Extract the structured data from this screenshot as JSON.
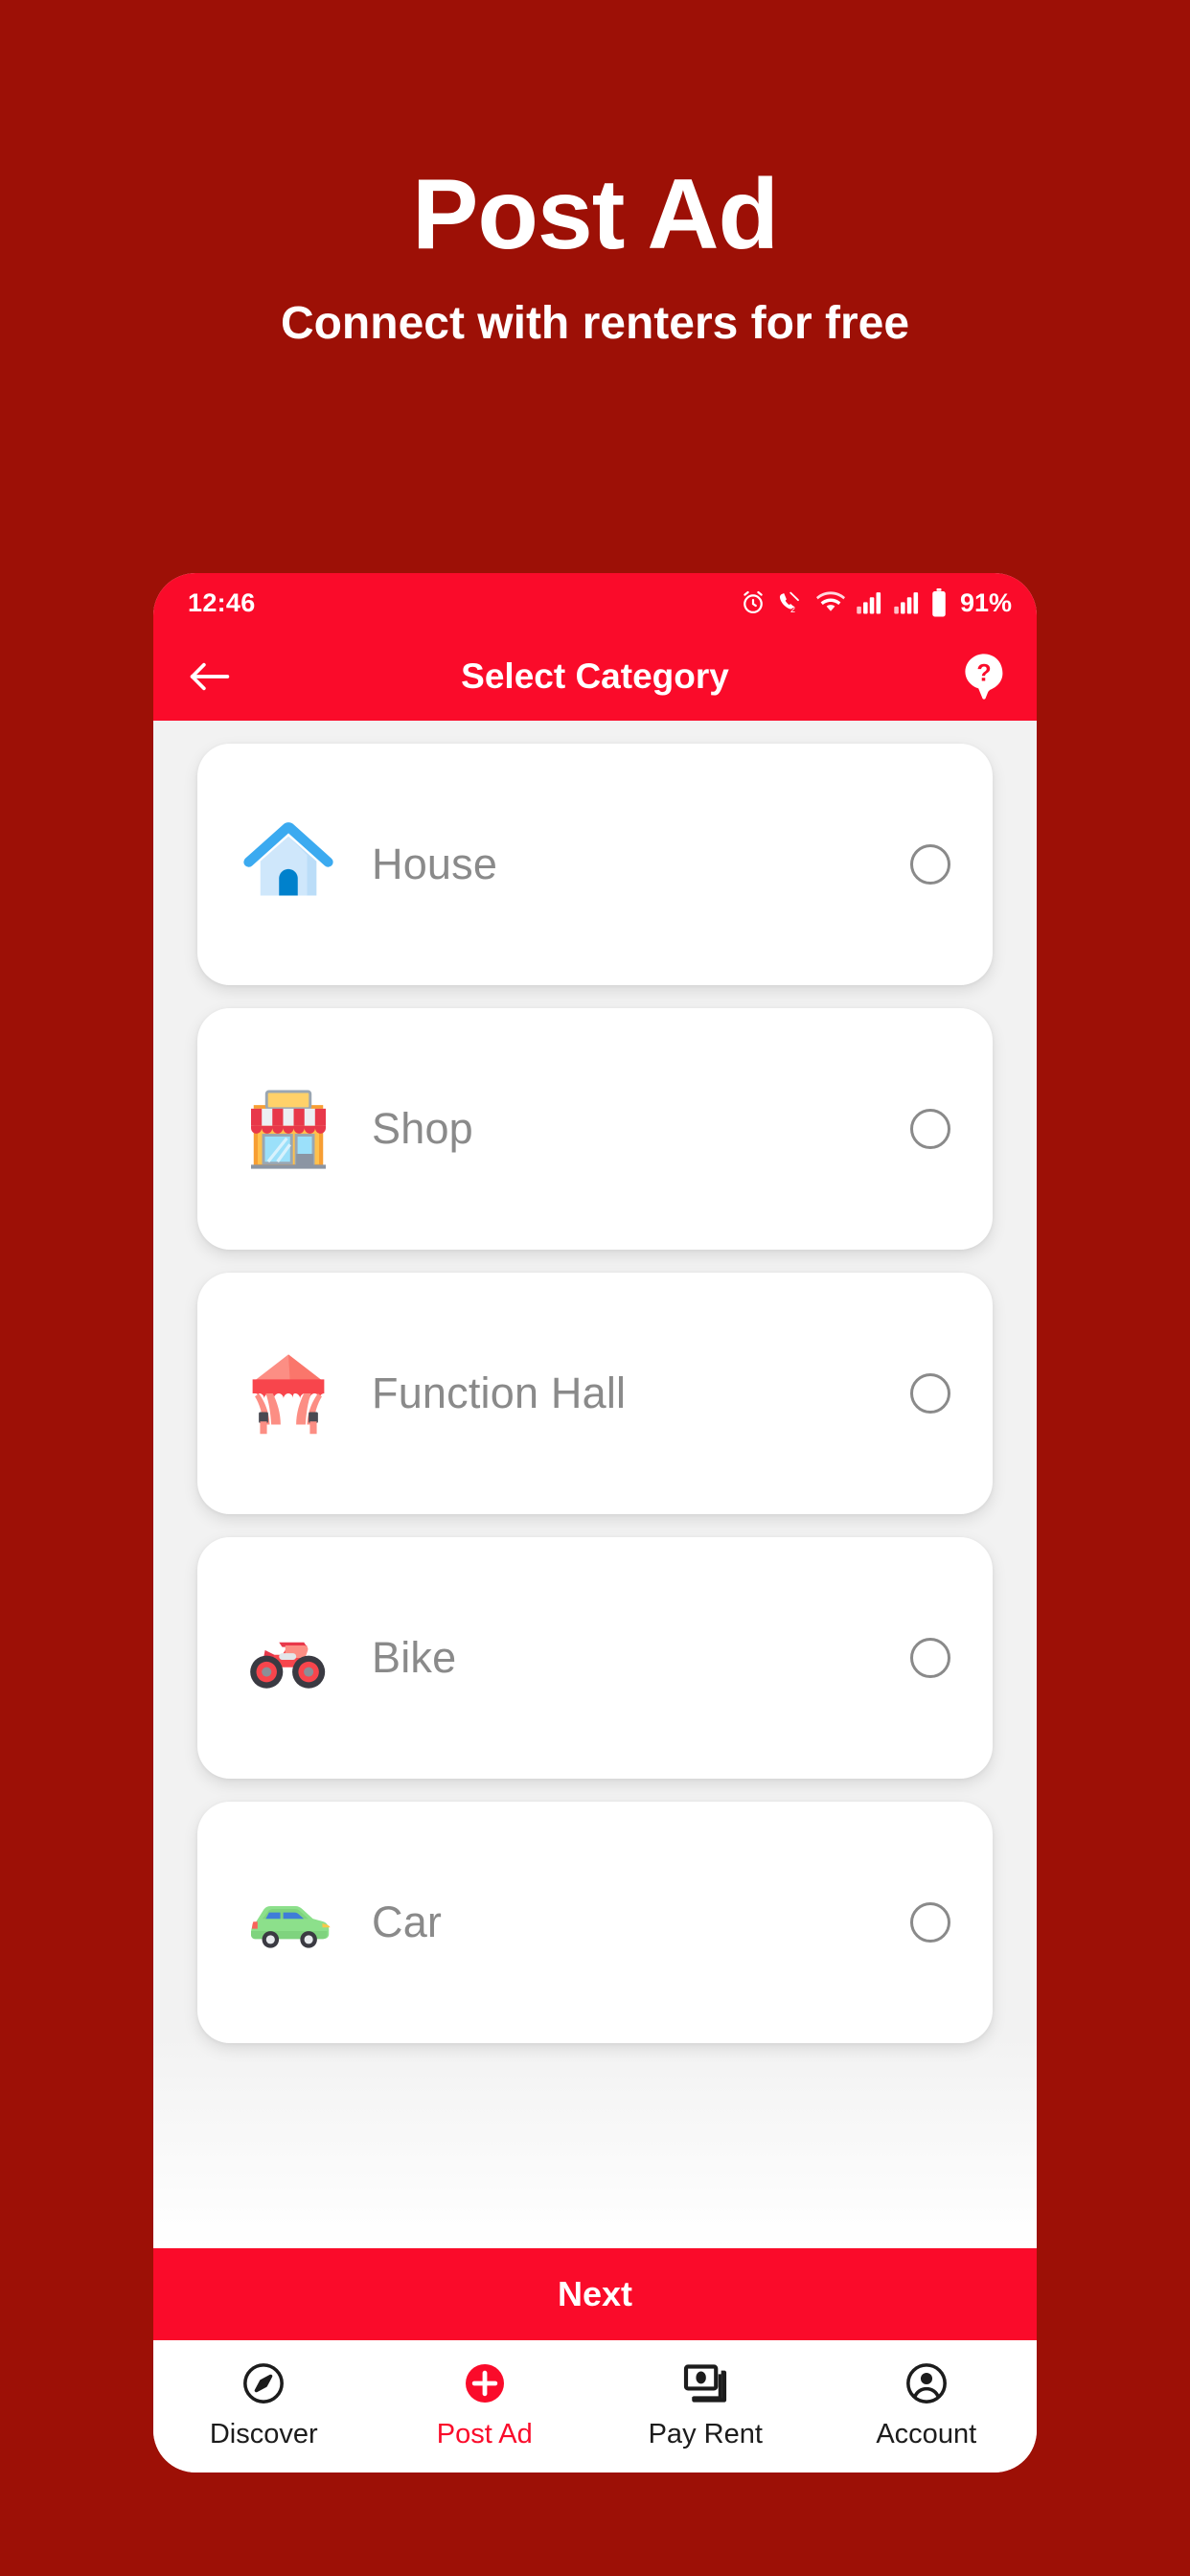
{
  "promo": {
    "title": "Post Ad",
    "subtitle": "Connect with renters for free",
    "background_color": "#9D1006",
    "text_color": "#FFFFFF"
  },
  "phone": {
    "statusbar": {
      "time": "12:46",
      "battery_percent": "91%",
      "icons": [
        "alarm-icon",
        "call-mute-dual-sim-icon",
        "wifi-icon",
        "signal-bars-1-icon",
        "signal-bars-2-icon",
        "battery-icon"
      ],
      "background_color": "#FA0B2A"
    },
    "appbar": {
      "back_label": "back-arrow-icon",
      "title": "Select Category",
      "help_label": "help-icon",
      "background_color": "#FA0B2A"
    },
    "categories": [
      {
        "label": "House",
        "icon": "house-icon",
        "selected": false
      },
      {
        "label": "Shop",
        "icon": "shop-icon",
        "selected": false
      },
      {
        "label": "Function Hall",
        "icon": "tent-icon",
        "selected": false
      },
      {
        "label": "Bike",
        "icon": "motorcycle-icon",
        "selected": false
      },
      {
        "label": "Car",
        "icon": "car-icon",
        "selected": false
      }
    ],
    "next_button": {
      "label": "Next",
      "background_color": "#FA0B2A",
      "text_color": "#FFFFFF"
    },
    "bottom_nav": {
      "active_color": "#FA0B2A",
      "inactive_color": "#1C1C1C",
      "items": [
        {
          "label": "Discover",
          "icon": "compass-icon",
          "active": false
        },
        {
          "label": "Post Ad",
          "icon": "plus-circle-icon",
          "active": true
        },
        {
          "label": "Pay Rent",
          "icon": "cards-icon",
          "active": false
        },
        {
          "label": "Account",
          "icon": "person-circle-icon",
          "active": false
        }
      ]
    }
  }
}
